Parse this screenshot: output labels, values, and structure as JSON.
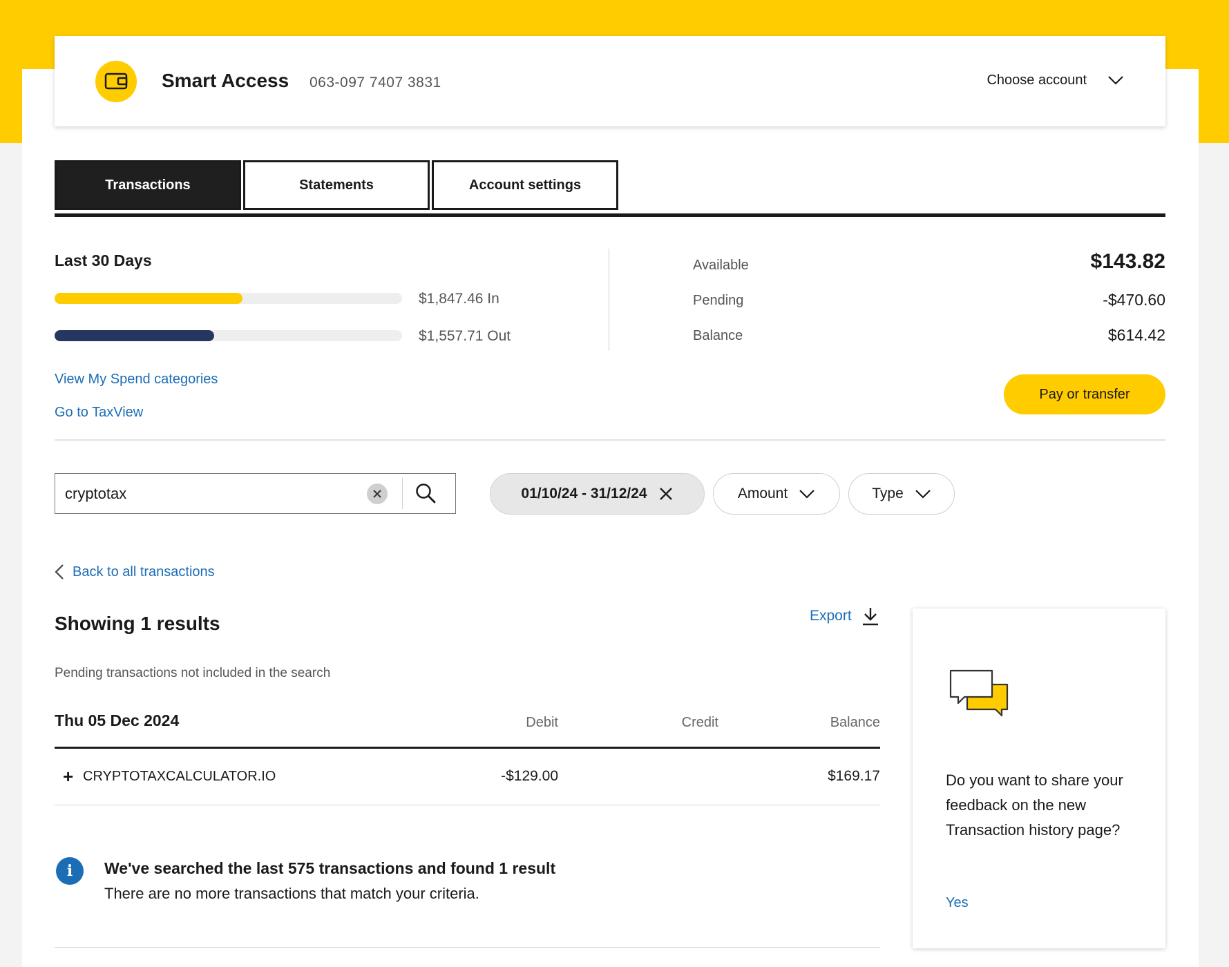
{
  "account": {
    "name": "Smart Access",
    "number": "063-097 7407 3831",
    "choose_label": "Choose account"
  },
  "tabs": [
    {
      "label": "Transactions",
      "active": true
    },
    {
      "label": "Statements",
      "active": false
    },
    {
      "label": "Account settings",
      "active": false
    }
  ],
  "summary": {
    "period_label": "Last 30 Days",
    "in": {
      "label": "$1,847.46 In",
      "fill_fraction": 0.54,
      "color": "#ffcc00"
    },
    "out": {
      "label": "$1,557.71 Out",
      "fill_fraction": 0.46,
      "color": "#26375f"
    },
    "links": {
      "spend": "View My Spend categories",
      "taxview": "Go to TaxView"
    },
    "available_label": "Available",
    "available_value": "$143.82",
    "pending_label": "Pending",
    "pending_value": "-$470.60",
    "balance_label": "Balance",
    "balance_value": "$614.42",
    "pay_button": "Pay or transfer"
  },
  "search": {
    "value": "cryptotax",
    "date_filter": "01/10/24 - 31/12/24",
    "amount_filter": "Amount",
    "type_filter": "Type"
  },
  "results": {
    "back_link": "Back to all transactions",
    "showing": "Showing 1 results",
    "export": "Export",
    "pending_note": "Pending transactions not included in the search",
    "date": "Thu 05 Dec 2024",
    "columns": {
      "debit": "Debit",
      "credit": "Credit",
      "balance": "Balance"
    },
    "rows": [
      {
        "description": "CRYPTOTAXCALCULATOR.IO",
        "debit": "-$129.00",
        "credit": "",
        "balance": "$169.17"
      }
    ],
    "info_title": "We've searched the last 575 transactions and found 1 result",
    "info_text": "There are no more transactions that match your criteria."
  },
  "feedback": {
    "question": "Do you want to share your feedback on the new Transaction history page?",
    "yes": "Yes"
  },
  "colors": {
    "brand_yellow": "#ffcc00",
    "link_blue": "#1b6db5",
    "dark": "#1f1f1f",
    "navy": "#26375f"
  },
  "icons": [
    "wallet-icon",
    "chevron-down-icon",
    "clear-icon",
    "search-icon",
    "close-icon",
    "chevron-left-icon",
    "download-icon",
    "plus-icon",
    "info-icon",
    "chat-bubbles-icon"
  ]
}
